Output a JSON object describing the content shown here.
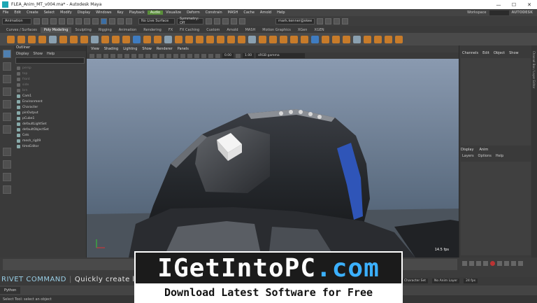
{
  "window": {
    "title": "FLEA_Anim_MT_v004.ma* - Autodesk Maya",
    "controls": [
      "—",
      "☐",
      "✕"
    ]
  },
  "menubar": {
    "items": [
      "File",
      "Edit",
      "Create",
      "Select",
      "Modify",
      "Display",
      "Windows",
      "Key",
      "Playback",
      "Audio",
      "Visualize",
      "Deform",
      "Constrain",
      "MASH",
      "Cache",
      "Arnold",
      "Help"
    ],
    "active_index": 9,
    "workspace_label": "Workspace",
    "brand": "AUTODESK"
  },
  "statusline": {
    "mode": "Animation",
    "live_surface": "No Live Surface",
    "symmetry": "Symmetry: Off",
    "user": "mark.kenner@skee"
  },
  "shelf": {
    "tabs": [
      "Curves / Surfaces",
      "Poly Modeling",
      "Sculpting",
      "Rigging",
      "Animation",
      "Rendering",
      "FX",
      "FX Caching",
      "Custom",
      "Arnold",
      "MASH",
      "Motion Graphics",
      "XGen",
      "XGEN"
    ],
    "active_index": 1
  },
  "outliner": {
    "title": "Outliner",
    "menu": [
      "Display",
      "Show",
      "Help"
    ],
    "items": [
      {
        "label": "persp",
        "dim": true
      },
      {
        "label": "top",
        "dim": true
      },
      {
        "label": "front",
        "dim": true
      },
      {
        "label": "side",
        "dim": true
      },
      {
        "label": "brn",
        "dim": true
      },
      {
        "label": "Cam1",
        "dim": false
      },
      {
        "label": "Environment",
        "dim": false
      },
      {
        "label": "Character",
        "dim": false
      },
      {
        "label": "pinOutput",
        "dim": false
      },
      {
        "label": "pCube1",
        "dim": false
      },
      {
        "label": "defaultLightSet",
        "dim": false
      },
      {
        "label": "defaultObjectSet",
        "dim": false
      },
      {
        "label": "Cels",
        "dim": false
      },
      {
        "label": "mesh_rig09",
        "dim": false
      },
      {
        "label": "timeEditor",
        "dim": false
      }
    ]
  },
  "viewport": {
    "menu": [
      "View",
      "Shading",
      "Lighting",
      "Show",
      "Renderer",
      "Panels"
    ],
    "value_a": "0.00",
    "value_b": "1.00",
    "colorspace": "sRGB gamma",
    "frame_label": "14.5 fps"
  },
  "channelbox": {
    "menu": [
      "Channels",
      "Edit",
      "Object",
      "Show"
    ],
    "layer_tabs": [
      "Display",
      "Anim"
    ],
    "layer_menu": [
      "Layers",
      "Options",
      "Help"
    ],
    "side_label": "Channel Box / Layer Editor"
  },
  "range": {
    "set": "Character Set",
    "layer": "No Anim Layer",
    "fps": "24 fps"
  },
  "cmdline": {
    "tab": "Python"
  },
  "helpline": {
    "text": "Select Tool: select an object"
  },
  "overlay": {
    "rivet_title": "RIVET COMMAND",
    "rivet_desc": "Quickly create loca"
  },
  "watermark": {
    "i": "I",
    "get": "Get",
    "into": "Into",
    "pc": "PC",
    "dot": ".",
    "com": "com",
    "tagline": "Download Latest Software for Free"
  },
  "colors": {
    "maya_blue": "#3f7cc0",
    "shelf_orange": "#c77b2a",
    "audio_green": "#5a8f3a",
    "watermark_blue": "#3bb0ff"
  }
}
